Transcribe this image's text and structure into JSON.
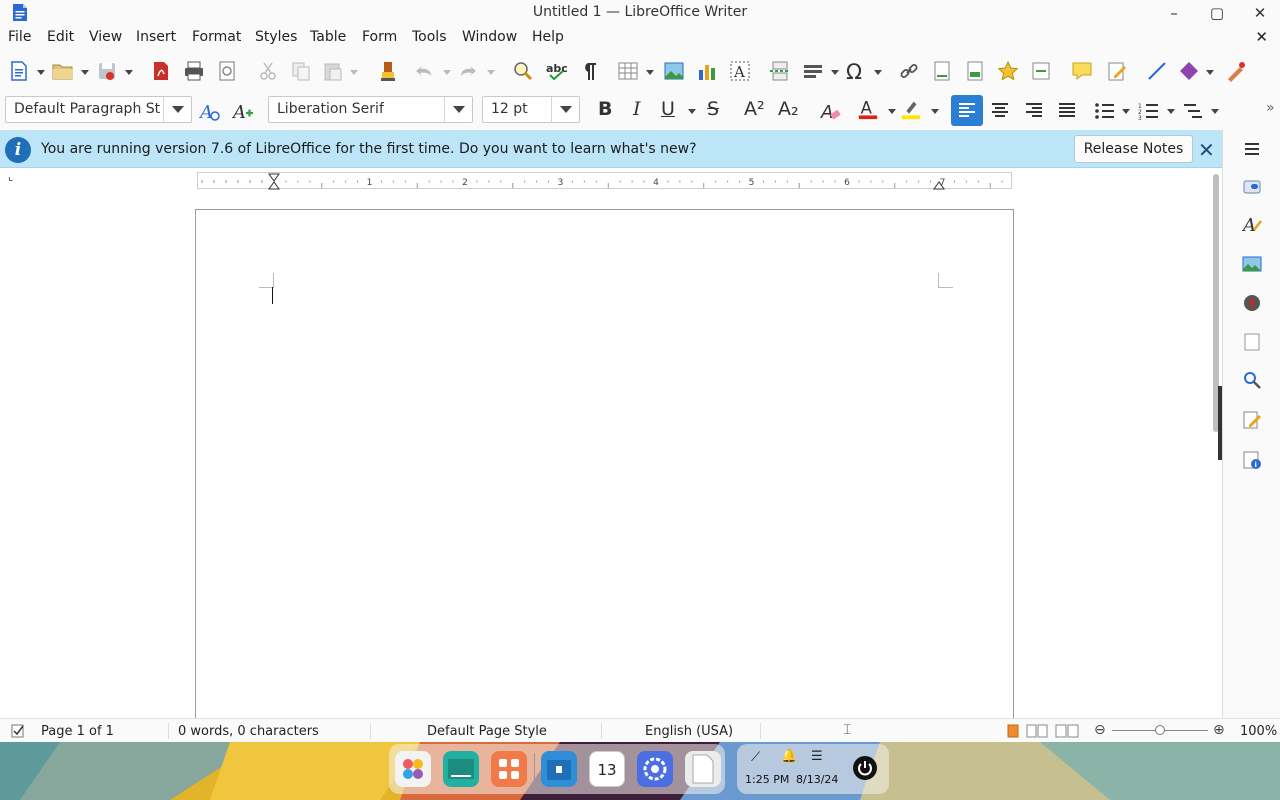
{
  "window": {
    "title": "Untitled 1 — LibreOffice Writer",
    "controls": {
      "minimize": "–",
      "maximize": "▢",
      "close": "✕"
    }
  },
  "menubar": {
    "items": [
      "File",
      "Edit",
      "View",
      "Insert",
      "Format",
      "Styles",
      "Table",
      "Form",
      "Tools",
      "Window",
      "Help"
    ],
    "close_label": "✕"
  },
  "formatting": {
    "paragraph_style": "Default Paragraph St",
    "font_name": "Liberation Serif",
    "font_size": "12 pt",
    "bold": "B",
    "italic": "I",
    "underline": "U",
    "strikethrough": "S",
    "superscript": "A²",
    "subscript": "A₂"
  },
  "infobar": {
    "message": "You are running version 7.6 of LibreOffice for the first time. Do you want to learn what's new?",
    "button_label": "Release Notes",
    "info_glyph": "i",
    "close_label": "✕"
  },
  "ruler": {
    "numbers": [
      "1",
      "2",
      "3",
      "4",
      "5",
      "6",
      "7"
    ]
  },
  "statusbar": {
    "page": "Page 1 of 1",
    "word_count": "0 words, 0 characters",
    "page_style": "Default Page Style",
    "language": "English (USA)",
    "zoom": "100%"
  },
  "taskbar": {
    "calendar_day": "13",
    "time": "1:25 PM",
    "date": "8/13/24"
  },
  "colors": {
    "infobar_bg": "#bde5f8",
    "accent_blue": "#1e6fb8",
    "align_left_active": "#2a7fd4",
    "font_color_red": "#e0201b",
    "highlight_yellow": "#ffe500"
  }
}
